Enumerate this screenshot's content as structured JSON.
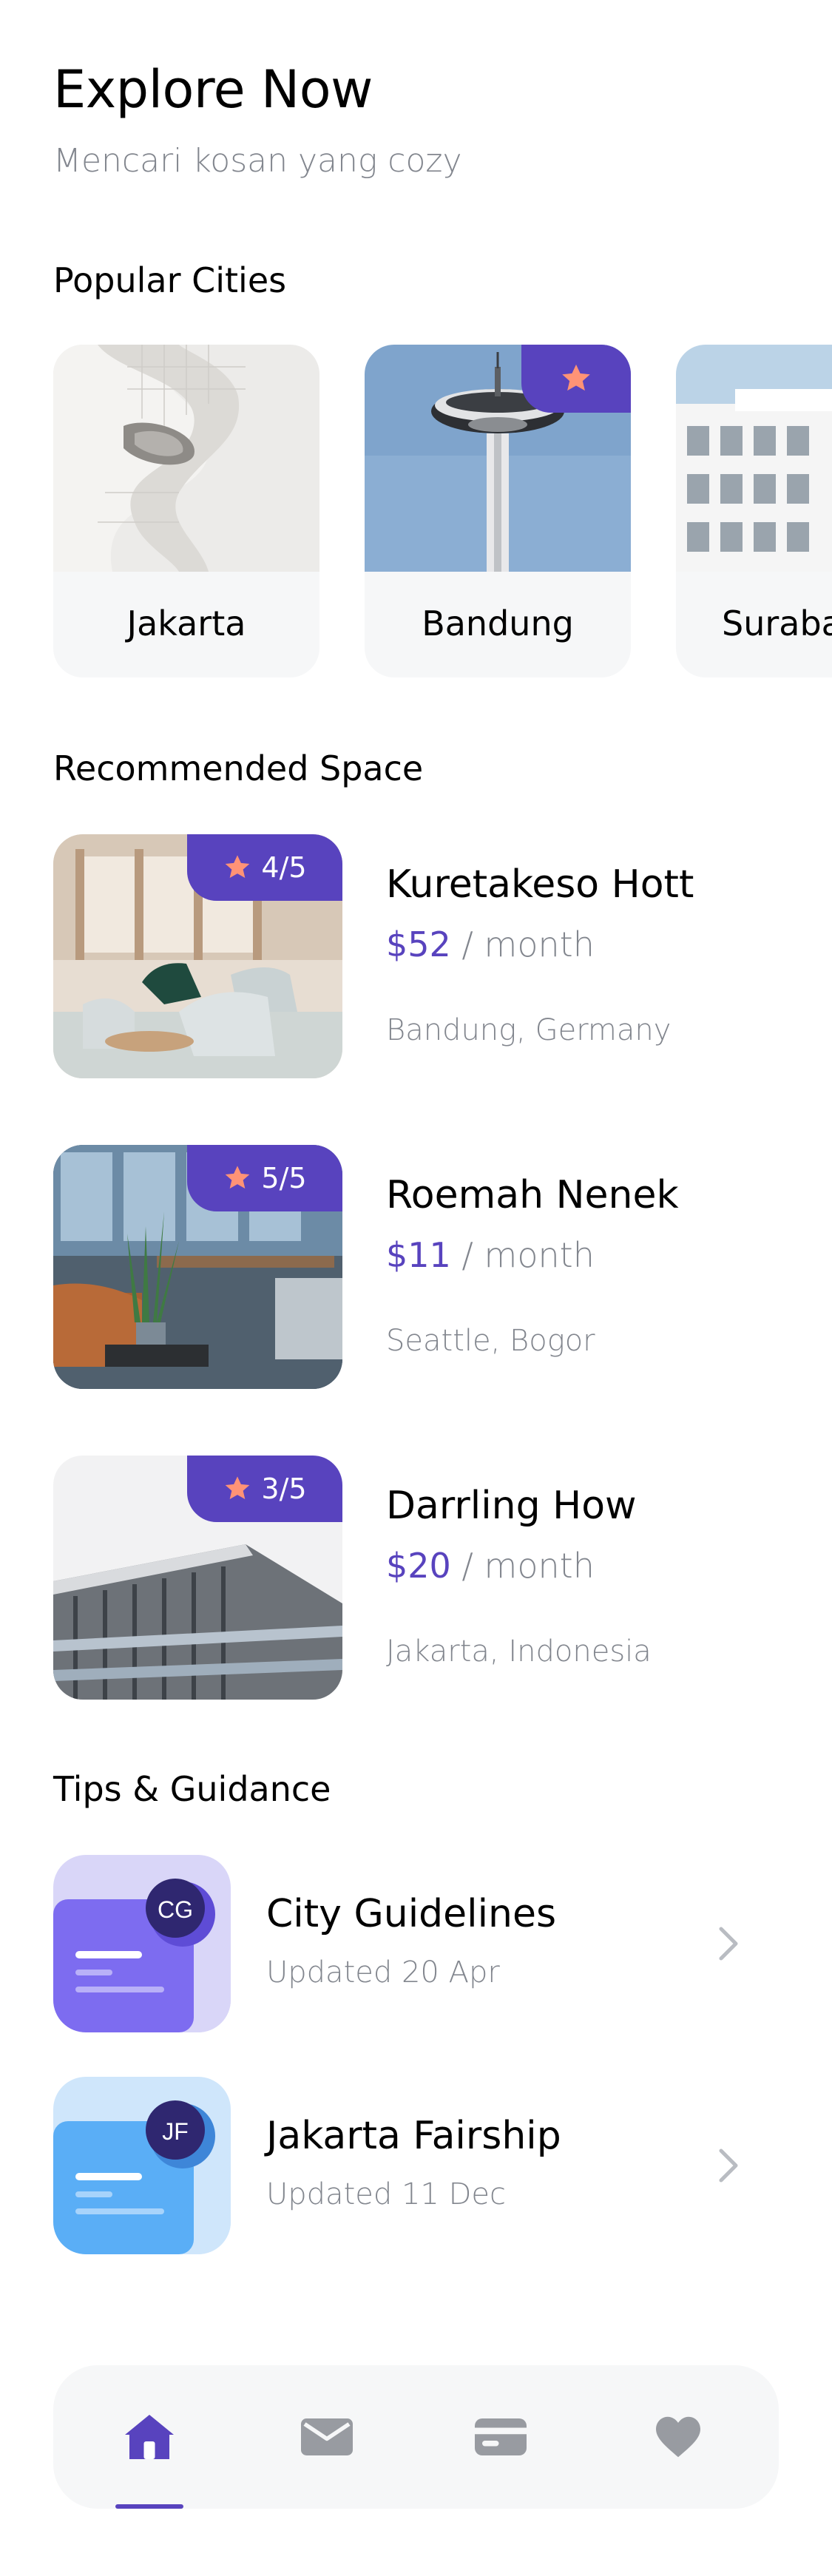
{
  "header": {
    "title": "Explore Now",
    "subtitle": "Mencari kosan yang cozy"
  },
  "popular": {
    "title": "Popular Cities",
    "cities": [
      {
        "name": "Jakarta",
        "featured": false
      },
      {
        "name": "Bandung",
        "featured": true
      },
      {
        "name": "Surabaya",
        "featured": false
      }
    ]
  },
  "recommended": {
    "title": "Recommended Space",
    "items": [
      {
        "name": "Kuretakeso Hott",
        "price": "$52",
        "period": " / month",
        "location": "Bandung, Germany",
        "rating": "4/5"
      },
      {
        "name": "Roemah Nenek",
        "price": "$11",
        "period": " / month",
        "location": "Seattle, Bogor",
        "rating": "5/5"
      },
      {
        "name": "Darrling How",
        "price": "$20",
        "period": " / month",
        "location": "Jakarta, Indonesia",
        "rating": "3/5"
      }
    ]
  },
  "tips": {
    "title": "Tips & Guidance",
    "items": [
      {
        "title": "City Guidelines",
        "updated": "Updated 20 Apr",
        "initials": "CG"
      },
      {
        "title": "Jakarta Fairship",
        "updated": "Updated 11 Dec",
        "initials": "JF"
      }
    ]
  },
  "nav": {
    "items": [
      "home-icon",
      "mail-icon",
      "card-icon",
      "heart-icon"
    ],
    "active": "home-icon"
  },
  "colors": {
    "accent": "#5843BE",
    "star": "#FF9376",
    "muted": "#82868E",
    "card_bg": "#F6F7F8"
  }
}
